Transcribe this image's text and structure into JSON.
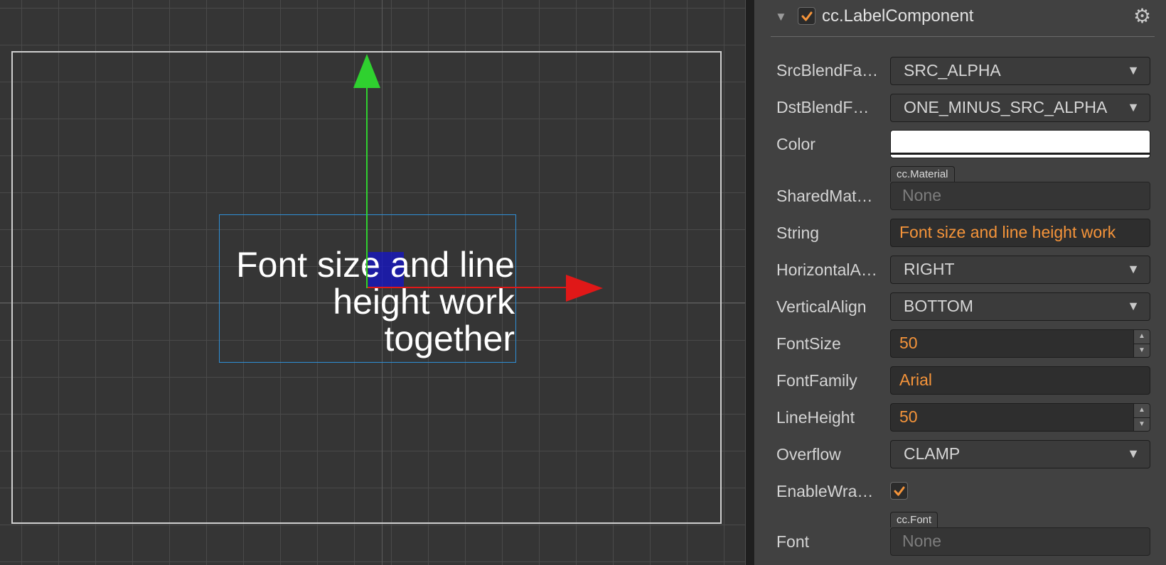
{
  "scene": {
    "label_text": "Font size and line\nheight work\ntogether",
    "colors": {
      "grid": "#4a4a4a",
      "bounds": "#2f8fd6",
      "gizmo_y": "#2fd12f",
      "gizmo_x": "#e01818",
      "anchor": "#1414c8"
    }
  },
  "inspector": {
    "component_title": "cc.LabelComponent",
    "component_enabled": true,
    "icons": {
      "fold": "triangle-down-icon",
      "settings": "gear-icon"
    },
    "accent": "#f5943a",
    "props": {
      "src_blend": {
        "label": "SrcBlendFa…",
        "value": "SRC_ALPHA"
      },
      "dst_blend": {
        "label": "DstBlendF…",
        "value": "ONE_MINUS_SRC_ALPHA"
      },
      "color": {
        "label": "Color",
        "value": "#ffffff"
      },
      "shared_materials": {
        "label": "SharedMat…",
        "type_tag": "cc.Material",
        "value": "None"
      },
      "string": {
        "label": "String",
        "value": "Font size and line height work"
      },
      "horizontal_align": {
        "label": "HorizontalA…",
        "value": "RIGHT"
      },
      "vertical_align": {
        "label": "VerticalAlign",
        "value": "BOTTOM"
      },
      "font_size": {
        "label": "FontSize",
        "value": "50"
      },
      "font_family": {
        "label": "FontFamily",
        "value": "Arial"
      },
      "line_height": {
        "label": "LineHeight",
        "value": "50"
      },
      "overflow": {
        "label": "Overflow",
        "value": "CLAMP"
      },
      "enable_wrap": {
        "label": "EnableWra…",
        "checked": true
      },
      "font": {
        "label": "Font",
        "type_tag": "cc.Font",
        "value": "None"
      }
    }
  }
}
